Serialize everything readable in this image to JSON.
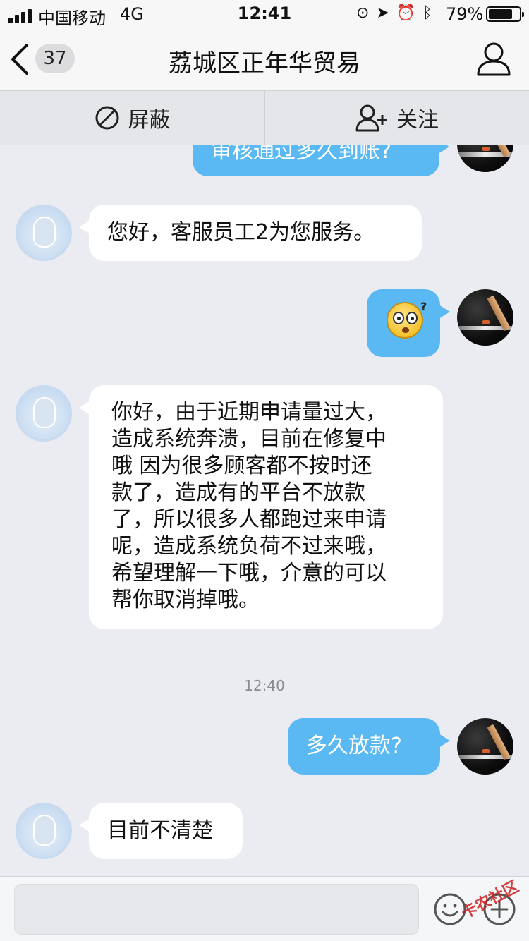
{
  "status_bar": {
    "carrier": "中国移动",
    "network": "4G",
    "time": "12:41",
    "battery_percent": "79%",
    "battery_level": 0.79
  },
  "nav": {
    "back_count": "37",
    "title": "荔城区正年华贸易"
  },
  "actions": {
    "block_label": "屏蔽",
    "follow_label": "关注"
  },
  "messages": {
    "m0": "审核通过多久到账?",
    "m1": "您好，客服员工2为您服务。",
    "m3_lines": [
      "你好，由于近期申请量过大，",
      "造成系统奔溃，目前在修复中",
      "哦  因为很多顾客都不按时还",
      "款了，造成有的平台不放款",
      "了，所以很多人都跑过来申请",
      "呢，造成系统负荷不过来哦，",
      "希望理解一下哦，介意的可以",
      "帮你取消掉哦。"
    ],
    "timestamp": "12:40",
    "m4": "多久放款?",
    "m5": "目前不清楚"
  },
  "input": {
    "placeholder": ""
  },
  "watermark": "卡农社区",
  "colors": {
    "outgoing_bubble": "#5ab9f2",
    "incoming_bubble": "#ffffff",
    "background": "#ebecf1"
  }
}
